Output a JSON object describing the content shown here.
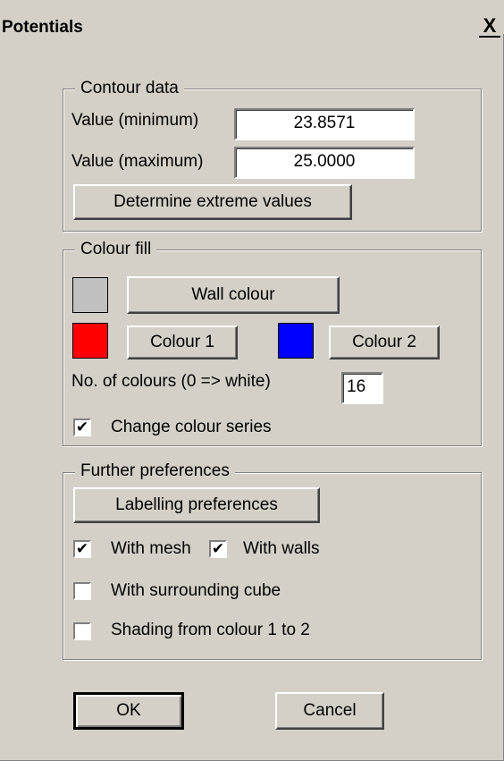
{
  "window": {
    "title": "Potentials",
    "close_glyph": "X"
  },
  "contour": {
    "legend": "Contour data",
    "min_label": "Value (minimum)",
    "min_value": "23.8571",
    "max_label": "Value (maximum)",
    "max_value": "25.0000",
    "determine_button": "Determine extreme values"
  },
  "colour_fill": {
    "legend": "Colour fill",
    "wall_colour_button": "Wall colour",
    "wall_swatch_color": "#c0c0c0",
    "colour1_button": "Colour 1",
    "colour1_swatch_color": "#ff0000",
    "colour2_button": "Colour 2",
    "colour2_swatch_color": "#0000ff",
    "num_colours_label": "No. of colours (0 => white)",
    "num_colours_value": "16",
    "change_series_label": "Change colour series",
    "change_series_checked": true
  },
  "further": {
    "legend": "Further preferences",
    "labelling_button": "Labelling preferences",
    "with_mesh_label": "With mesh",
    "with_mesh_checked": true,
    "with_walls_label": "With walls",
    "with_walls_checked": true,
    "surrounding_cube_label": "With surrounding cube",
    "surrounding_cube_checked": false,
    "shading_label": "Shading from colour 1 to 2",
    "shading_checked": false
  },
  "buttons": {
    "ok": "OK",
    "cancel": "Cancel"
  },
  "check_glyph": "✔"
}
